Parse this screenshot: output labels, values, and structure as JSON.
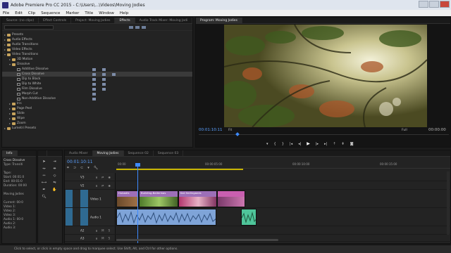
{
  "window": {
    "title": "Adobe Premiere Pro CC 2015 - C:\\Users\\...\\Videos\\Moving Jodies"
  },
  "menu": [
    "File",
    "Edit",
    "Clip",
    "Sequence",
    "Marker",
    "Title",
    "Window",
    "Help"
  ],
  "top_tabs": [
    "Source: (no clips)",
    "Effect Controls",
    "Project: Moving Jodies",
    "Effects",
    "Audio Track Mixer: Moving Jodi"
  ],
  "effects": {
    "active_tab": "Effects",
    "items": [
      {
        "label": "Presets",
        "depth": 0,
        "kind": "folder",
        "open": false
      },
      {
        "label": "Audio Effects",
        "depth": 0,
        "kind": "folder",
        "open": false
      },
      {
        "label": "Audio Transitions",
        "depth": 0,
        "kind": "folder",
        "open": false
      },
      {
        "label": "Video Effects",
        "depth": 0,
        "kind": "folder",
        "open": false
      },
      {
        "label": "Video Transitions",
        "depth": 0,
        "kind": "folder",
        "open": true
      },
      {
        "label": "3D Motion",
        "depth": 1,
        "kind": "folder",
        "open": false
      },
      {
        "label": "Dissolve",
        "depth": 1,
        "kind": "folder",
        "open": true
      },
      {
        "label": "Additive Dissolve",
        "depth": 2,
        "kind": "fx",
        "badges": 2
      },
      {
        "label": "Cross Dissolve",
        "depth": 2,
        "kind": "fx",
        "badges": 3,
        "selected": true
      },
      {
        "label": "Dip to Black",
        "depth": 2,
        "kind": "fx",
        "badges": 2
      },
      {
        "label": "Dip to White",
        "depth": 2,
        "kind": "fx",
        "badges": 2
      },
      {
        "label": "Film Dissolve",
        "depth": 2,
        "kind": "fx",
        "badges": 2
      },
      {
        "label": "Morph Cut",
        "depth": 2,
        "kind": "fx",
        "badges": 1
      },
      {
        "label": "Non-Additive Dissolve",
        "depth": 2,
        "kind": "fx",
        "badges": 1
      },
      {
        "label": "Iris",
        "depth": 1,
        "kind": "folder",
        "open": false
      },
      {
        "label": "Page Peel",
        "depth": 1,
        "kind": "folder",
        "open": false
      },
      {
        "label": "Slide",
        "depth": 1,
        "kind": "folder",
        "open": false
      },
      {
        "label": "Wipe",
        "depth": 1,
        "kind": "folder",
        "open": false
      },
      {
        "label": "Zoom",
        "depth": 1,
        "kind": "folder",
        "open": false
      },
      {
        "label": "Lumetri Presets",
        "depth": 0,
        "kind": "folder",
        "open": false
      }
    ]
  },
  "program": {
    "tab": "Program: Moving Jodies",
    "timecode": "00:01:10:11",
    "fit": "Fit",
    "quality": "Full",
    "duration": "00:00:00"
  },
  "info": {
    "tab": "Info",
    "lines": [
      "Cross Dissolve",
      "Type: Transiti",
      "",
      "Tape:",
      "Start: 00:01:0",
      "End: 00:01:0",
      "Duration: 00:00",
      "",
      "Moving Jodies",
      "",
      "Current: 00:0",
      "Video 1: ",
      "Video 2:",
      "Video 3:",
      "Audio 1: 00:0",
      "Audio 2:",
      "Audio 3:"
    ]
  },
  "timeline": {
    "tabs": [
      "Audio Mixer",
      "Moving Jodies",
      "Sequence 02",
      "Sequence 03"
    ],
    "active_tab": "Moving Jodies",
    "timecode": "00:01:10:11",
    "ruler": [
      "00:00",
      "00:00:05:00",
      "00:00:10:00",
      "00:00:15:00",
      "00:00:20:00"
    ],
    "tracks": [
      {
        "name": "V3",
        "kind": "video"
      },
      {
        "name": "V2",
        "kind": "video"
      },
      {
        "name": "Video 1",
        "kind": "video",
        "src": "V1"
      },
      {
        "name": "Audio 1",
        "kind": "audio",
        "src": "A1"
      },
      {
        "name": "A2",
        "kind": "audio"
      },
      {
        "name": "A3",
        "kind": "audio"
      }
    ],
    "clips": [
      "Hubadis",
      "Building-Ballerinas",
      "Kat Hallinganes"
    ]
  },
  "status": {
    "text": "Click to select, or click in empty space and drag to marquee select. Use Shift, Alt, and Ctrl for other options."
  },
  "colors": {
    "accent": "#3d8aff",
    "track_target": "#2f6a92",
    "video_clip": "#9d6fb8",
    "audio_clip": "#7fa4d8",
    "audio_clip_alt": "#4fc59a"
  }
}
